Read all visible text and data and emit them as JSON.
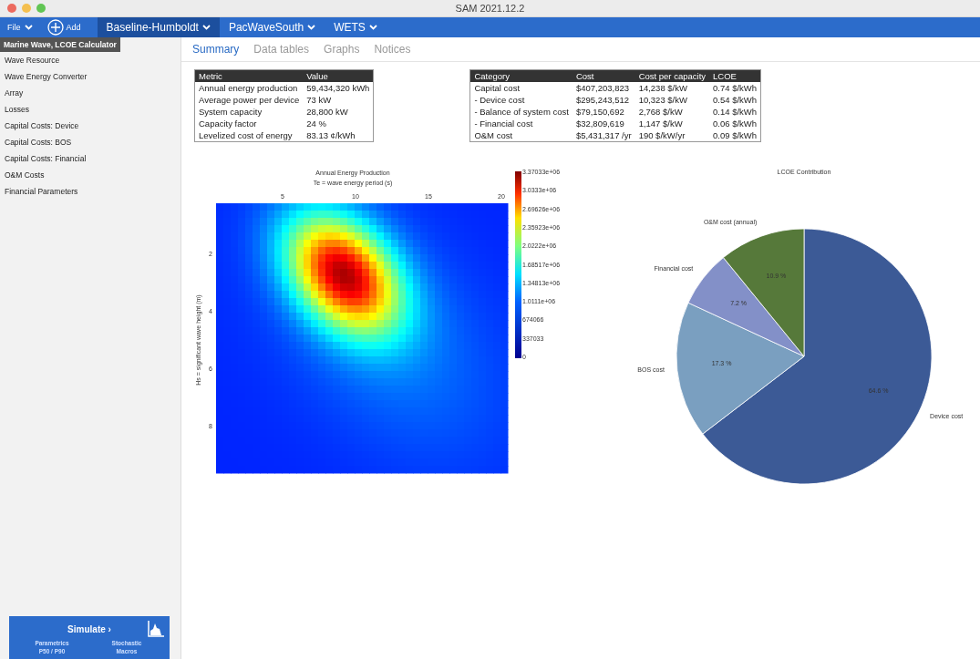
{
  "window": {
    "title": "SAM 2021.12.2"
  },
  "toolbar": {
    "file_menu": "File",
    "add_button": "Add",
    "cases": [
      {
        "label": "Baseline-Humboldt",
        "selected": true
      },
      {
        "label": "PacWaveSouth",
        "selected": false
      },
      {
        "label": "WETS",
        "selected": false
      }
    ]
  },
  "sidebar": {
    "header": "Marine Wave, LCOE Calculator",
    "items": [
      "Wave Resource",
      "Wave Energy Converter",
      "Array",
      "Losses",
      "Capital Costs: Device",
      "Capital Costs: BOS",
      "Capital Costs: Financial",
      "O&M Costs",
      "Financial Parameters"
    ],
    "simulate": "Simulate ›",
    "links": [
      "Parametrics",
      "Stochastic",
      "P50 / P90",
      "Macros"
    ]
  },
  "tabs": [
    {
      "label": "Summary",
      "selected": true
    },
    {
      "label": "Data tables",
      "selected": false
    },
    {
      "label": "Graphs",
      "selected": false
    },
    {
      "label": "Notices",
      "selected": false
    }
  ],
  "metrics_table": {
    "columns": [
      "Metric",
      "Value"
    ],
    "rows": [
      [
        "Annual energy production",
        "59,434,320 kWh"
      ],
      [
        "Average power per device",
        "73 kW"
      ],
      [
        "System capacity",
        "28,800 kW"
      ],
      [
        "Capacity factor",
        "24 %"
      ],
      [
        "Levelized cost of energy",
        "83.13 ¢/kWh"
      ]
    ]
  },
  "cost_table": {
    "columns": [
      "Category",
      "Cost",
      "Cost per capacity",
      "LCOE"
    ],
    "rows": [
      [
        "Capital cost",
        "$407,203,823",
        "14,238 $/kW",
        "0.74 $/kWh"
      ],
      [
        "-  Device cost",
        "$295,243,512",
        "10,323 $/kW",
        "0.54 $/kWh"
      ],
      [
        "-  Balance of system cost",
        "$79,150,692",
        "2,768 $/kW",
        "0.14 $/kWh"
      ],
      [
        "-  Financial cost",
        "$32,809,619",
        "1,147 $/kW",
        "0.06 $/kWh"
      ],
      [
        "O&M cost",
        "$5,431,317 /yr",
        "190 $/kW/yr",
        "0.09 $/kWh"
      ]
    ]
  },
  "heatmap": {
    "title": "Annual Energy Production",
    "xlabel": "Te = wave energy period (s)",
    "ylabel": "Hs = significant wave height (m)",
    "xticks": [
      "5",
      "10",
      "15",
      "20"
    ],
    "yticks": [
      "2",
      "4",
      "6",
      "8"
    ],
    "colorbar": [
      "3.37033e+06",
      "3.0333e+06",
      "2.69626e+06",
      "2.35923e+06",
      "2.0222e+06",
      "1.68517e+06",
      "1.34813e+06",
      "1.0111e+06",
      "674066",
      "337033",
      "0"
    ]
  },
  "pie": {
    "chart_data": {
      "type": "pie",
      "title": "LCOE Contribution",
      "categories": [
        "Device cost",
        "BOS cost",
        "Financial cost",
        "O&M cost (annual)"
      ],
      "values": [
        64.6,
        17.3,
        7.2,
        10.9
      ],
      "colors": [
        "#3c5a96",
        "#7a9fc0",
        "#8390c8",
        "#56793a"
      ],
      "value_labels": [
        "64.6 %",
        "17.3 %",
        "7.2 %",
        "10.9 %"
      ]
    }
  }
}
